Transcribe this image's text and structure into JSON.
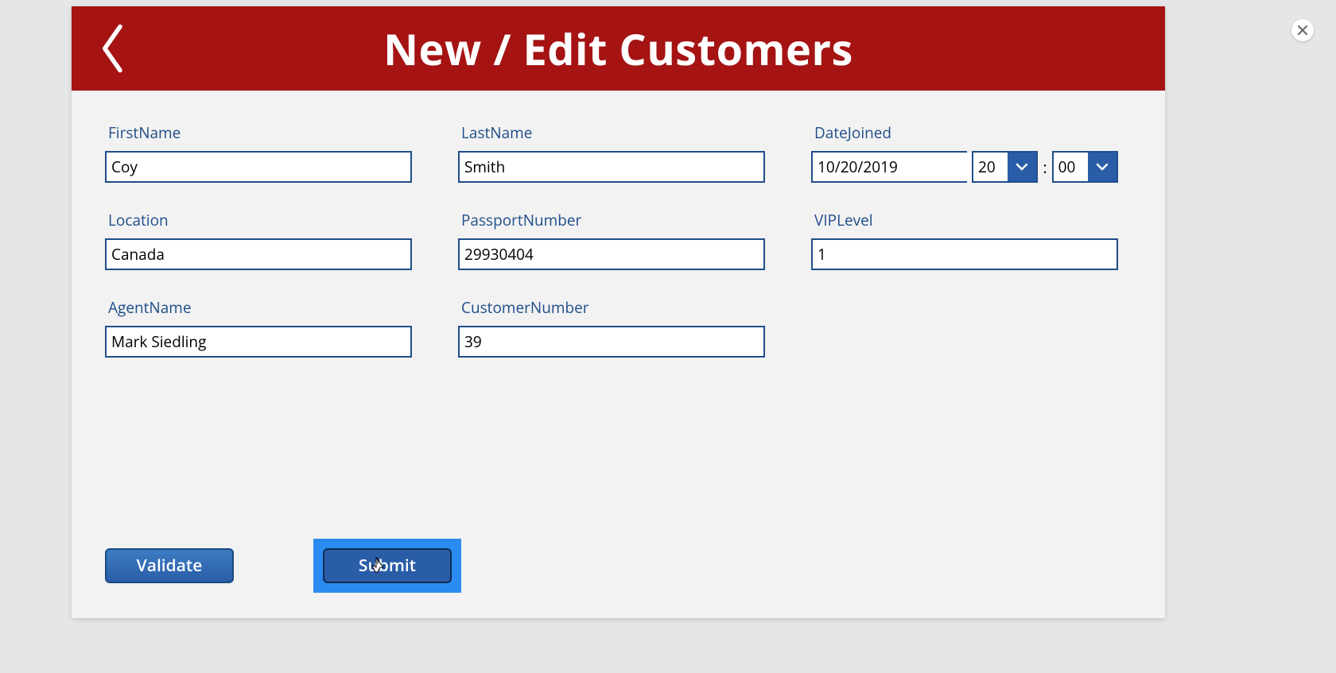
{
  "header": {
    "title": "New / Edit Customers"
  },
  "fields": {
    "firstName": {
      "label": "FirstName",
      "value": "Coy"
    },
    "lastName": {
      "label": "LastName",
      "value": "Smith"
    },
    "dateJoined": {
      "label": "DateJoined",
      "date": "10/20/2019",
      "hour": "20",
      "minute": "00"
    },
    "location": {
      "label": "Location",
      "value": "Canada"
    },
    "passportNumber": {
      "label": "PassportNumber",
      "value": "29930404"
    },
    "vipLevel": {
      "label": "VIPLevel",
      "value": "1"
    },
    "agentName": {
      "label": "AgentName",
      "value": "Mark Siedling"
    },
    "customerNumber": {
      "label": "CustomerNumber",
      "value": "39"
    }
  },
  "buttons": {
    "validate": "Validate",
    "submit": "Submit"
  },
  "timeSeparator": ":"
}
